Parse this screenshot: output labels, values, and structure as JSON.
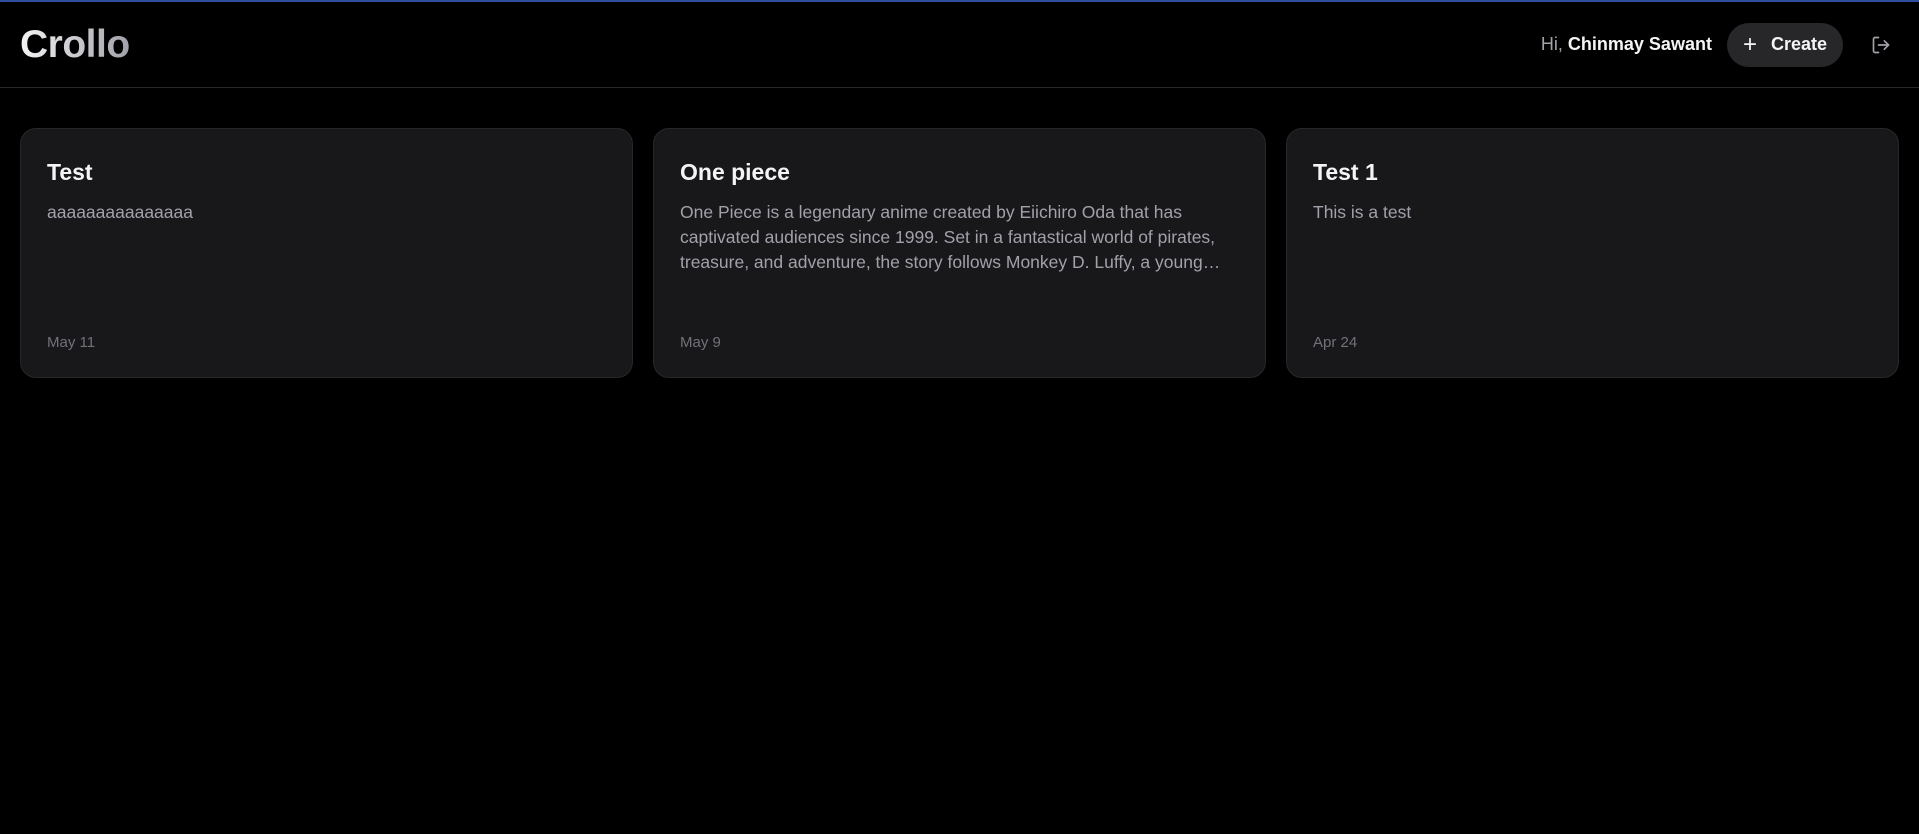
{
  "app": {
    "logo": "Crollo"
  },
  "header": {
    "greeting_prefix": "Hi,",
    "user_name": "Chinmay Sawant",
    "create_label": "Create",
    "create_icon": "plus-icon",
    "logout_icon": "logout-icon"
  },
  "colors": {
    "background": "#000000",
    "card": "#18181b",
    "border": "#27272a",
    "accent_line": "#2f4f9e"
  },
  "cards": [
    {
      "title": "Test",
      "description": "aaaaaaaaaaaaaaa",
      "date": "May 11"
    },
    {
      "title": "One piece",
      "description": "One Piece is a legendary anime created by Eiichiro Oda that has captivated audiences since 1999. Set in a fantastical world of pirates, treasure, and adventure, the story follows Monkey D. Luffy, a young pirate whose body gained the properties of rubber after eating a Devil Fruit.",
      "date": "May 9"
    },
    {
      "title": "Test 1",
      "description": "This is a test",
      "date": "Apr 24"
    }
  ]
}
